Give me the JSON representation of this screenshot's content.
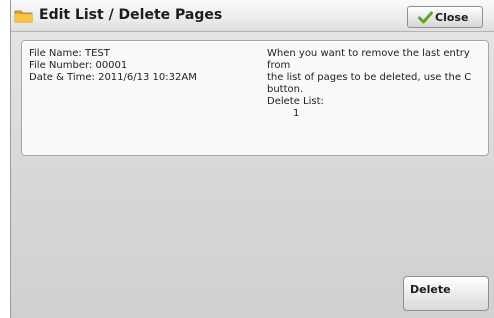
{
  "dialog": {
    "title": "Edit List / Delete Pages",
    "close_label": "Close"
  },
  "file_info": {
    "file_name": "File Name: TEST",
    "file_number": "File Number: 00001",
    "date_time": "Date & Time: 2011/6/13 10:32AM"
  },
  "help": {
    "text_line1": "When you want to remove the last entry from",
    "text_line2": "the list of pages to be deleted, use the C",
    "text_line3": "button.",
    "delete_list_label": "Delete List:",
    "delete_list_value": "1"
  },
  "actions": {
    "delete_label": "Delete"
  },
  "icons": {
    "title": "folder-icon",
    "close": "check-icon"
  },
  "colors": {
    "folder": "#f0b020",
    "check": "#6cbf2a"
  }
}
